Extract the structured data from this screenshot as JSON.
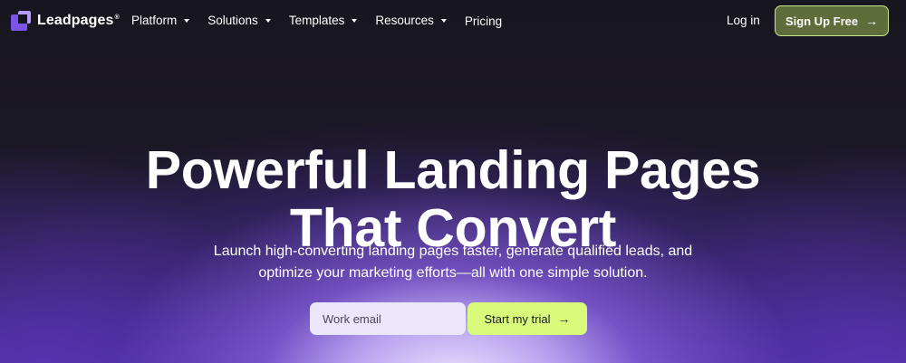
{
  "nav": {
    "logo": {
      "text": "Leadpages",
      "trademark": "®"
    },
    "menu": [
      {
        "label": "Platform",
        "has_dropdown": true
      },
      {
        "label": "Solutions",
        "has_dropdown": true
      },
      {
        "label": "Templates",
        "has_dropdown": true
      },
      {
        "label": "Resources",
        "has_dropdown": true
      },
      {
        "label": "Pricing",
        "has_dropdown": false
      }
    ],
    "login_label": "Log in",
    "signup_label": "Sign Up Free",
    "signup_icon": "arrow-right-icon"
  },
  "hero": {
    "title_line1": "Powerful Landing Pages",
    "title_line2": "That Convert",
    "subtitle_line1": "Launch high-converting landing pages faster, generate qualified leads, and",
    "subtitle_line2": "optimize your marketing efforts—all with one simple solution.",
    "email_placeholder": "Work email",
    "trial_label": "Start my trial",
    "trial_icon": "arrow-right-icon"
  },
  "colors": {
    "background": "#16151d",
    "brand_purple": "#7b55e8",
    "signup_bg": "#5e6d39",
    "signup_border": "#c9e68a",
    "trial_bg": "#d8f97a",
    "email_bg": "#ebe6fb"
  }
}
